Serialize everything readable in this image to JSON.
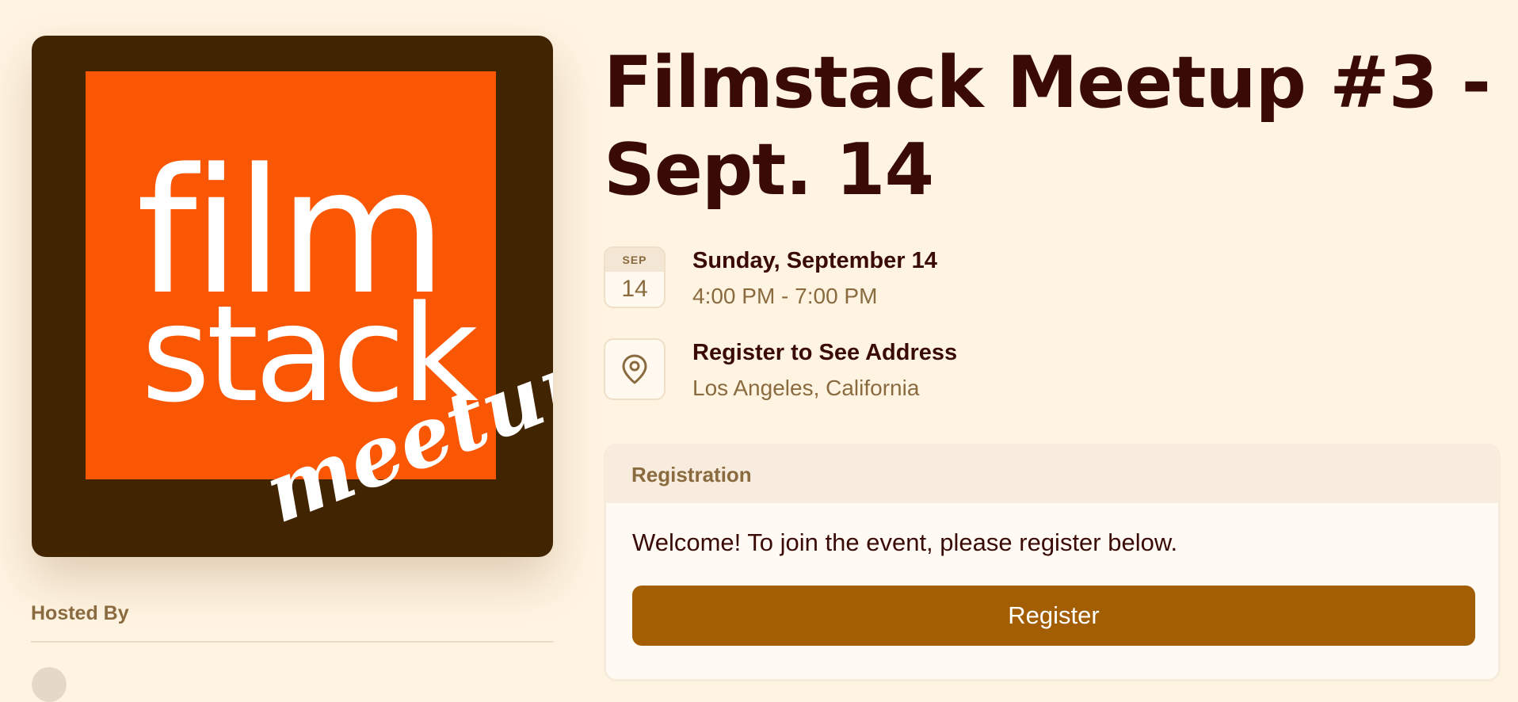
{
  "cover": {
    "logo_line1": "film",
    "logo_line2": "stack",
    "logo_line3": "meetup"
  },
  "host": {
    "label": "Hosted By"
  },
  "event": {
    "title": "Filmstack Meetup #3 - Sept. 14",
    "date": {
      "month": "SEP",
      "day": "14",
      "full": "Sunday, September 14",
      "time": "4:00 PM - 7:00 PM"
    },
    "location": {
      "primary": "Register to See Address",
      "secondary": "Los Angeles, California",
      "icon": "map-pin-icon"
    }
  },
  "registration": {
    "header": "Registration",
    "message": "Welcome! To join the event, please register below.",
    "button_label": "Register"
  },
  "colors": {
    "background": "#fff4e2",
    "accent": "#a35d03",
    "logo_orange": "#fa5705",
    "logo_brown": "#412400",
    "heading": "#3a0a06",
    "muted": "#8a6a3f"
  }
}
